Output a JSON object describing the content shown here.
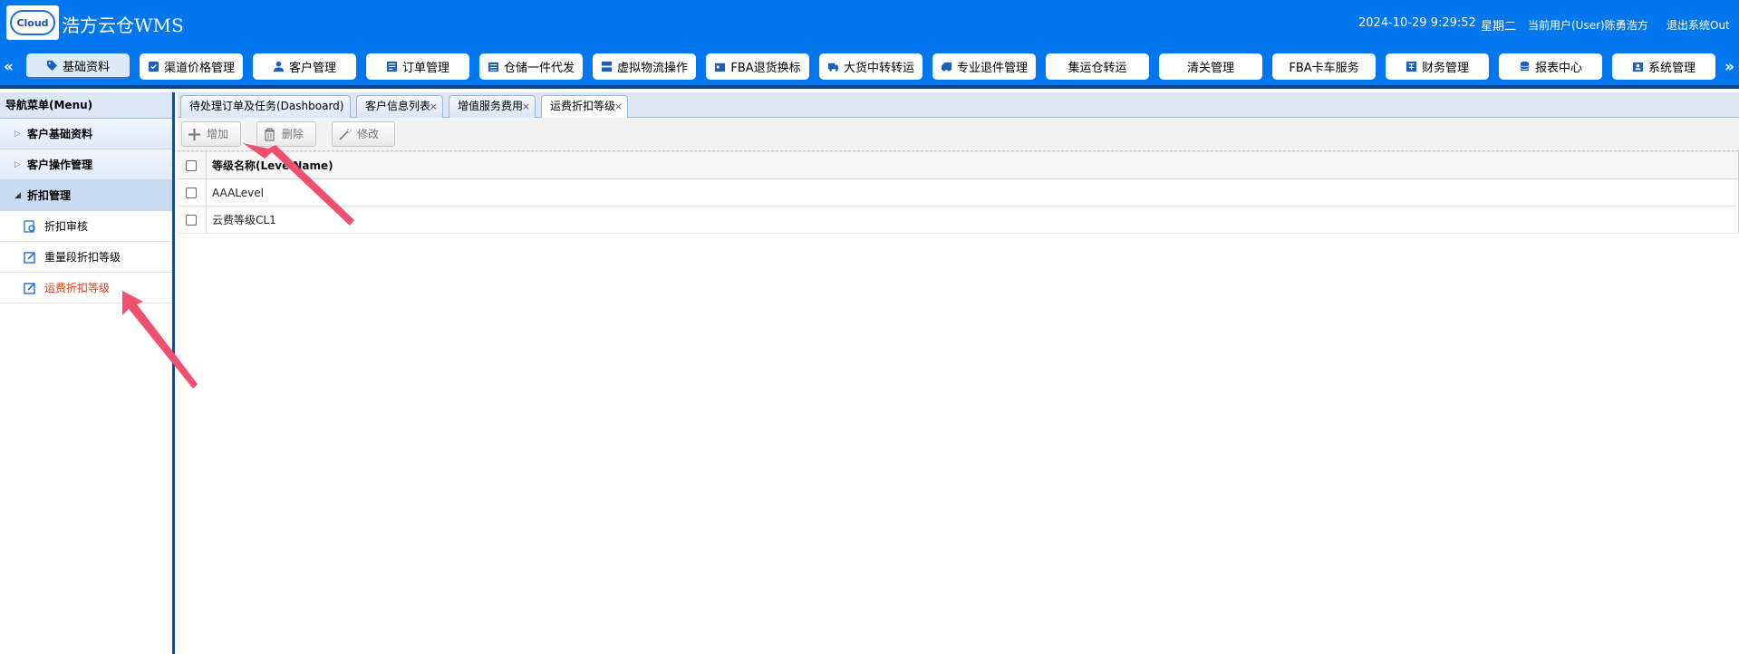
{
  "header": {
    "logo_text": "Cloud",
    "app_title": "浩方云仓WMS",
    "datetime": "2024-10-29 9:29:52",
    "weekday": "星期二",
    "current_user": "当前用户(User)陈勇浩方",
    "logout": "退出系统Out"
  },
  "nav": {
    "prev_arrow": "«",
    "next_arrow": "»",
    "items": [
      {
        "label": "基础资料",
        "icon": "tag-icon"
      },
      {
        "label": "渠道价格管理",
        "icon": "price-icon"
      },
      {
        "label": "客户管理",
        "icon": "user-icon"
      },
      {
        "label": "订单管理",
        "icon": "order-icon"
      },
      {
        "label": "仓储一件代发",
        "icon": "warehouse-icon"
      },
      {
        "label": "虚拟物流操作",
        "icon": "logistics-icon"
      },
      {
        "label": "FBA退货换标",
        "icon": "return-icon"
      },
      {
        "label": "大货中转转运",
        "icon": "truck-icon"
      },
      {
        "label": "专业退件管理",
        "icon": "return-truck-icon"
      },
      {
        "label": "集运仓转运",
        "icon": ""
      },
      {
        "label": "清关管理",
        "icon": ""
      },
      {
        "label": "FBA卡车服务",
        "icon": ""
      },
      {
        "label": "财务管理",
        "icon": "finance-icon"
      },
      {
        "label": "报表中心",
        "icon": "database-icon"
      },
      {
        "label": "系统管理",
        "icon": "settings-icon"
      }
    ]
  },
  "sidebar": {
    "title": "导航菜单(Menu)",
    "groups": [
      {
        "label": "客户基础资料"
      },
      {
        "label": "客户操作管理"
      },
      {
        "label": "折扣管理"
      }
    ],
    "items": [
      {
        "label": "折扣审核"
      },
      {
        "label": "重量段折扣等级"
      },
      {
        "label": "运费折扣等级"
      }
    ]
  },
  "tabs": [
    {
      "label": "待处理订单及任务(Dashboard)"
    },
    {
      "label": "客户信息列表"
    },
    {
      "label": "增值服务费用"
    },
    {
      "label": "运费折扣等级"
    }
  ],
  "tab_close": "×",
  "toolbar": {
    "add": "增加",
    "delete": "删除",
    "edit": "修改"
  },
  "grid": {
    "header": "等级名称(LevelName)",
    "rows": [
      "AAALevel",
      "云费等级CL1"
    ]
  },
  "colors": {
    "header_bg": "#0077ee",
    "active_menu_text": "#e0401a",
    "annotation_arrow": "#f0506e"
  }
}
